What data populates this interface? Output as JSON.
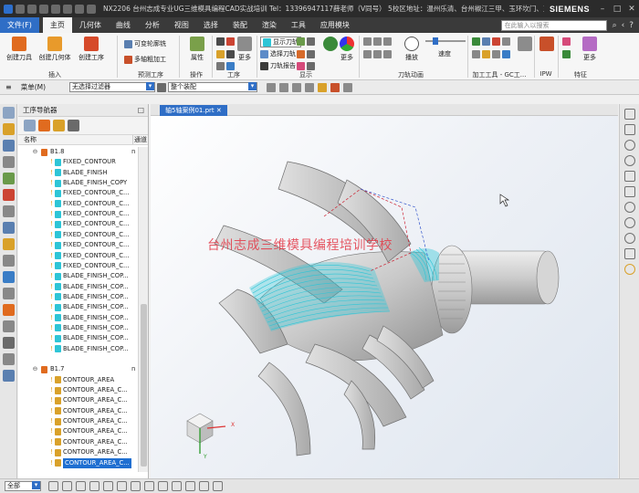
{
  "app": {
    "title": "NX2206 台州志成专业UG三维模具编程CAD实战培训 Tel：13396947117薛老师（V同号） 5校区地址：温州乐清、台州椒江三甲、玉环坎门、玉环沙门、玉环芦浦 - 加工",
    "brand": "SIEMENS",
    "window_controls": [
      "–",
      "□",
      "✕"
    ]
  },
  "menu_tabs": [
    {
      "label": "文件(F)",
      "style": "file"
    },
    {
      "label": "主页",
      "style": "active"
    },
    {
      "label": "几何体"
    },
    {
      "label": "曲线"
    },
    {
      "label": "分析"
    },
    {
      "label": "视图"
    },
    {
      "label": "选择"
    },
    {
      "label": "装配"
    },
    {
      "label": "渲染"
    },
    {
      "label": "工具"
    },
    {
      "label": "应用模块"
    }
  ],
  "search": {
    "placeholder": "在此输入以搜索"
  },
  "ribbon": {
    "buttons": {
      "create_tool": "创建刀具",
      "create_geometry": "创建几何体",
      "create_operation": "创建工序",
      "variable_contour": "可变轮廓铣",
      "multi_blade": "多轴粗加工",
      "properties": "属性",
      "more1": "更多",
      "more2": "更多",
      "more3": "更多",
      "show_path": "显示刀轨",
      "select_path": "选择刀轨",
      "path_report": "刀轨报告",
      "play": "播放",
      "speed": "速度",
      "more4": "更多"
    },
    "groups": {
      "insert": "插入",
      "preset": "预测工序",
      "operation": "操作",
      "process": "工序",
      "display": "显示",
      "path_anim": "刀轨动画",
      "machining_tools": "加工工具 - GC工...",
      "ipw": "IPW",
      "feature": "特征"
    }
  },
  "selection_bar": {
    "menu": "菜单(M)",
    "filter": "无选择过滤器",
    "scope": "整个装配"
  },
  "navigator": {
    "title": "工序导航器",
    "col_name": "名称",
    "col_status": "通道",
    "rows": [
      {
        "indent": 1,
        "toggle": "⊖",
        "label": "B1.8",
        "mark": "n",
        "kind": "group"
      },
      {
        "indent": 2,
        "label": "FIXED_CONTOUR",
        "kind": "op"
      },
      {
        "indent": 2,
        "label": "BLADE_FINISH",
        "kind": "op"
      },
      {
        "indent": 2,
        "label": "BLADE_FINISH_COPY",
        "kind": "op"
      },
      {
        "indent": 2,
        "label": "FIXED_CONTOUR_C...",
        "kind": "op"
      },
      {
        "indent": 2,
        "label": "FIXED_CONTOUR_C...",
        "kind": "op"
      },
      {
        "indent": 2,
        "label": "FIXED_CONTOUR_C...",
        "kind": "op"
      },
      {
        "indent": 2,
        "label": "FIXED_CONTOUR_C...",
        "kind": "op"
      },
      {
        "indent": 2,
        "label": "FIXED_CONTOUR_C...",
        "kind": "op"
      },
      {
        "indent": 2,
        "label": "FIXED_CONTOUR_C...",
        "kind": "op"
      },
      {
        "indent": 2,
        "label": "FIXED_CONTOUR_C...",
        "kind": "op"
      },
      {
        "indent": 2,
        "label": "FIXED_CONTOUR_C...",
        "kind": "op"
      },
      {
        "indent": 2,
        "label": "BLADE_FINISH_COP...",
        "kind": "op"
      },
      {
        "indent": 2,
        "label": "BLADE_FINISH_COP...",
        "kind": "op"
      },
      {
        "indent": 2,
        "label": "BLADE_FINISH_COP...",
        "kind": "op"
      },
      {
        "indent": 2,
        "label": "BLADE_FINISH_COP...",
        "kind": "op"
      },
      {
        "indent": 2,
        "label": "BLADE_FINISH_COP...",
        "kind": "op"
      },
      {
        "indent": 2,
        "label": "BLADE_FINISH_COP...",
        "kind": "op"
      },
      {
        "indent": 2,
        "label": "BLADE_FINISH_COP...",
        "kind": "op"
      },
      {
        "indent": 2,
        "label": "BLADE_FINISH_COP...",
        "kind": "op"
      },
      {
        "indent": 1,
        "toggle": "",
        "label": "",
        "kind": "blank"
      },
      {
        "indent": 1,
        "toggle": "⊖",
        "label": "B1.7",
        "mark": "n",
        "kind": "group"
      },
      {
        "indent": 2,
        "label": "CONTOUR_AREA",
        "kind": "op2"
      },
      {
        "indent": 2,
        "label": "CONTOUR_AREA_C...",
        "kind": "op2"
      },
      {
        "indent": 2,
        "label": "CONTOUR_AREA_C...",
        "kind": "op2"
      },
      {
        "indent": 2,
        "label": "CONTOUR_AREA_C...",
        "kind": "op2"
      },
      {
        "indent": 2,
        "label": "CONTOUR_AREA_C...",
        "kind": "op2"
      },
      {
        "indent": 2,
        "label": "CONTOUR_AREA_C...",
        "kind": "op2"
      },
      {
        "indent": 2,
        "label": "CONTOUR_AREA_C...",
        "kind": "op2"
      },
      {
        "indent": 2,
        "label": "CONTOUR_AREA_C...",
        "kind": "op2"
      },
      {
        "indent": 2,
        "label": "CONTOUR_AREA_C...",
        "kind": "op2",
        "selected": true
      }
    ]
  },
  "graphics": {
    "file_tab": "轴5轴案例01.prt",
    "watermark": "台州志成三维模具编程培训学校",
    "triad": {
      "x": "X",
      "y": "Y"
    }
  },
  "status": {
    "scope": "全部"
  },
  "colors": {
    "accent": "#2f6ec6",
    "toolpath": "#2ec5d6",
    "watermark": "#e33a48"
  }
}
